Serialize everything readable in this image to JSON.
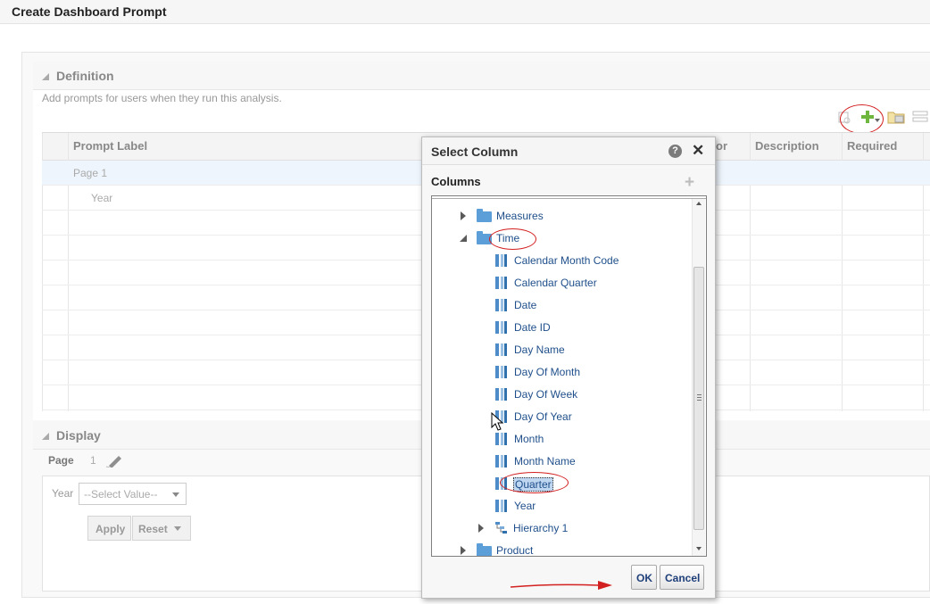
{
  "window": {
    "title": "Create Dashboard Prompt"
  },
  "definition": {
    "heading": "Definition",
    "description": "Add prompts for users when they run this analysis.",
    "columns": [
      "Prompt Label",
      "or",
      "Description",
      "Required"
    ],
    "rows": [
      {
        "label": "Page 1",
        "selected": true
      },
      {
        "label": "Year",
        "selected": false
      }
    ]
  },
  "display": {
    "heading": "Display",
    "page_label": "Page",
    "page_number": "1",
    "prompt_label": "Year",
    "select_placeholder": "--Select Value--",
    "apply_label": "Apply",
    "reset_label": "Reset"
  },
  "dialog": {
    "title": "Select Column",
    "help_icon": "?",
    "close_icon": "✕",
    "columns_label": "Columns",
    "add_icon": "+",
    "tree": {
      "measures": "Measures",
      "time": "Time",
      "time_columns": [
        "Calendar Month Code",
        "Calendar Quarter",
        "Date",
        "Date ID",
        "Day Name",
        "Day Of Month",
        "Day Of Week",
        "Day Of Year",
        "Month",
        "Month Name",
        "Quarter",
        "Year"
      ],
      "hierarchy": "Hierarchy 1",
      "product": "Product"
    },
    "ok_label": "OK",
    "cancel_label": "Cancel"
  },
  "colors": {
    "link": "#1f4f8b",
    "annotation_red": "#d32020",
    "add_green": "#6fb63f"
  }
}
